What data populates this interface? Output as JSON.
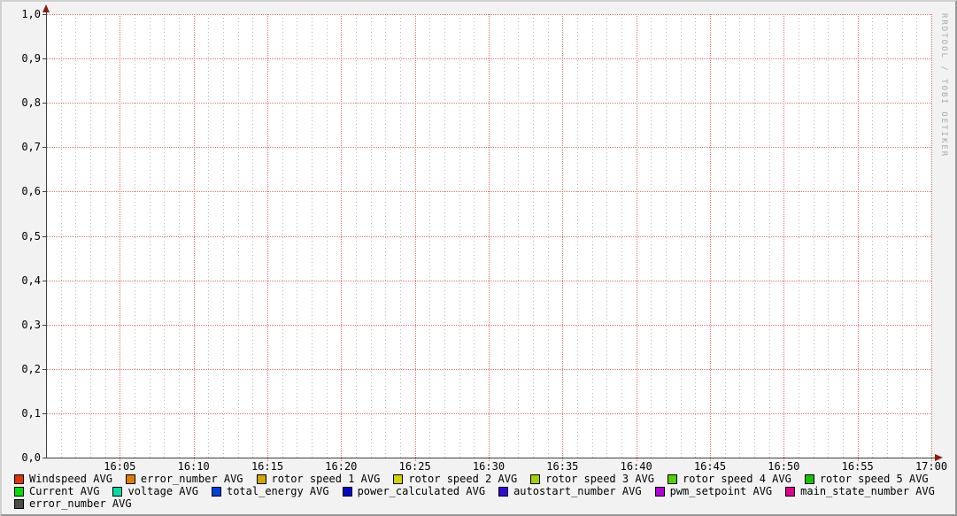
{
  "watermark": "RRDTOOL / TOBI OETIKER",
  "colors": {
    "background": "#F2F2F2",
    "canvas": "#FFFFFF",
    "major_grid": "#E45A5A",
    "minor_grid": "#828282",
    "axis": "#404040",
    "arrow": "#8B1A10",
    "watermark_text": "#A8A8A8",
    "legend_text": "#000000",
    "border_light": "#D0D0D0",
    "border_dark": "#979797"
  },
  "chart_data": {
    "type": "line",
    "x_tick_labels": [
      "16:05",
      "16:10",
      "16:15",
      "16:20",
      "16:25",
      "16:30",
      "16:35",
      "16:40",
      "16:45",
      "16:50",
      "16:55",
      "17:00"
    ],
    "x_range_implied": [
      "16:00",
      "17:00"
    ],
    "x_minor_ticks_per_major": 5,
    "y_tick_labels": [
      "0,0",
      "0,1",
      "0,2",
      "0,3",
      "0,4",
      "0,5",
      "0,6",
      "0,7",
      "0,8",
      "0,9",
      "1,0"
    ],
    "ylim": [
      0.0,
      1.0
    ],
    "grid": true,
    "legend_position": "bottom",
    "series_values_visible": false,
    "series": [
      {
        "label": "Windspeed AVG",
        "color": "#E23200"
      },
      {
        "label": "error_number AVG",
        "color": "#DD7D00"
      },
      {
        "label": "rotor speed 1 AVG",
        "color": "#D0A800"
      },
      {
        "label": "rotor speed 2 AVG",
        "color": "#D2D200"
      },
      {
        "label": "rotor speed 3 AVG",
        "color": "#A2D200"
      },
      {
        "label": "rotor speed 4 AVG",
        "color": "#55D000"
      },
      {
        "label": "rotor speed 5 AVG",
        "color": "#14C400"
      },
      {
        "label": "Current AVG",
        "color": "#00E000"
      },
      {
        "label": "voltage AVG",
        "color": "#00DCA4"
      },
      {
        "label": "total_energy AVG",
        "color": "#0340E0"
      },
      {
        "label": "power_calculated AVG",
        "color": "#0008C8"
      },
      {
        "label": "autostart_number AVG",
        "color": "#3208D8"
      },
      {
        "label": "pwm_setpoint AVG",
        "color": "#B400D4"
      },
      {
        "label": "main_state_number AVG",
        "color": "#E0008C"
      },
      {
        "label": "error_number AVG",
        "color": "#4D4D4D"
      }
    ],
    "legend_rows": [
      7,
      7,
      1
    ]
  }
}
